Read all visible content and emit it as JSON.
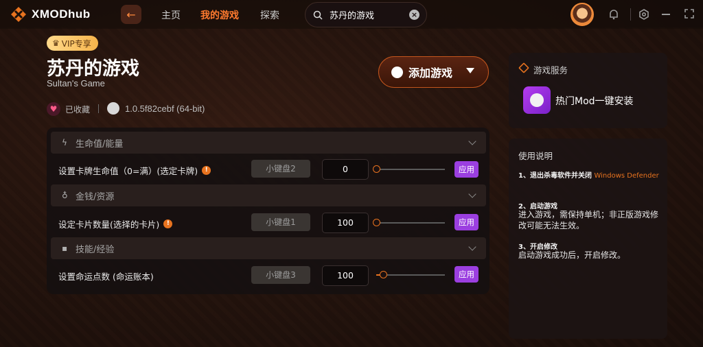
{
  "app": {
    "brand": "XMODhub"
  },
  "nav": {
    "items": [
      "主页",
      "我的游戏",
      "探索"
    ],
    "active_index": 1
  },
  "search": {
    "value": "苏丹的游戏"
  },
  "topbar_icons": [
    "back-arrow-icon",
    "search-icon",
    "clear-icon",
    "avatar",
    "bell-icon",
    "settings-icon",
    "minimize-icon",
    "expand-icon"
  ],
  "game": {
    "vip_badge": "VIP专享",
    "title": "苏丹的游戏",
    "subtitle": "Sultan's Game",
    "favorite_label": "已收藏",
    "version": "1.0.5f82cebf (64-bit)",
    "add_button": "添加游戏"
  },
  "cheats": {
    "sections": [
      {
        "title": "生命值/能量",
        "icon": "lightning-icon",
        "rows": [
          {
            "label": "设置卡牌生命值（0=满）(选定卡牌)",
            "info": "!",
            "hotkey": "小键盘2",
            "value": "0",
            "slider": 0.0,
            "apply": "应用"
          }
        ]
      },
      {
        "title": "金钱/资源",
        "icon": "money-bag-icon",
        "rows": [
          {
            "label": "设定卡片数量(选择的卡片)",
            "info": "!",
            "hotkey": "小键盘1",
            "value": "100",
            "slider": 0.0,
            "apply": "应用"
          }
        ]
      },
      {
        "title": "技能/经验",
        "icon": "bar-chart-icon",
        "rows": [
          {
            "label": "设置命运点数 (命运账本)",
            "hotkey": "小键盘3",
            "value": "100",
            "slider": 0.1,
            "apply": "应用"
          }
        ]
      }
    ]
  },
  "services": {
    "title": "游戏服务",
    "item": "热门Mod一键安装"
  },
  "instructions": {
    "title": "使用说明",
    "steps": [
      {
        "head": "1、退出杀毒软件并关闭",
        "head_highlight": "Windows Defender",
        "body": ""
      },
      {
        "head": "2、启动游戏",
        "body": "进入游戏，需保持单机；非正版游戏修改可能无法生效。"
      },
      {
        "head": "3、开启修改",
        "body": "启动游戏成功后，开启修改。"
      }
    ]
  },
  "colors": {
    "accent": "#e8731f",
    "apply": "#9b3fe0",
    "vip": "#f6b44b"
  }
}
